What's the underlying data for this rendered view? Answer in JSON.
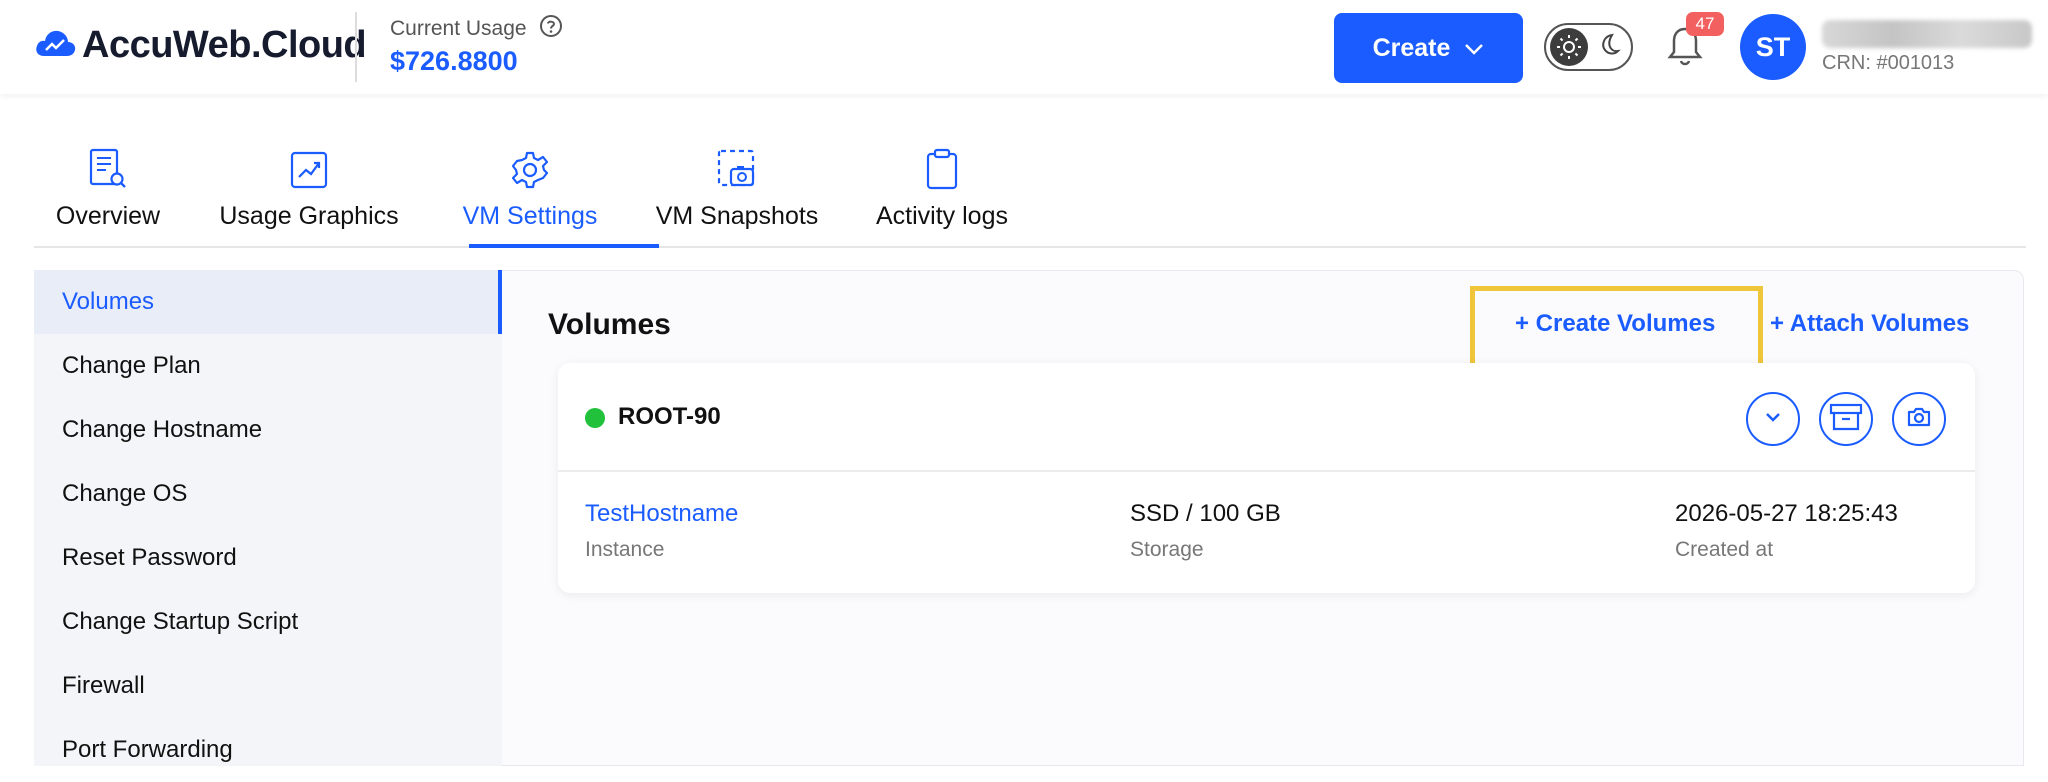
{
  "header": {
    "logo_text": "AccuWeb.Cloud",
    "usage_label": "Current Usage",
    "usage_value": "$726.8800",
    "create_label": "Create",
    "notification_count": "47",
    "avatar_initials": "ST",
    "crn": "CRN: #001013"
  },
  "tabs": [
    {
      "label": "Overview",
      "icon": "document-search-icon"
    },
    {
      "label": "Usage Graphics",
      "icon": "chart-trend-icon"
    },
    {
      "label": "VM Settings",
      "icon": "gear-icon",
      "active": true
    },
    {
      "label": "VM Snapshots",
      "icon": "snapshot-icon"
    },
    {
      "label": "Activity logs",
      "icon": "clipboard-icon"
    }
  ],
  "sidebar": {
    "items": [
      {
        "label": "Volumes",
        "active": true
      },
      {
        "label": "Change Plan"
      },
      {
        "label": "Change Hostname"
      },
      {
        "label": "Change OS"
      },
      {
        "label": "Reset Password"
      },
      {
        "label": "Change Startup Script"
      },
      {
        "label": "Firewall"
      },
      {
        "label": "Port Forwarding"
      }
    ]
  },
  "main": {
    "title": "Volumes",
    "create_link": "+ Create Volumes",
    "attach_link": "+ Attach Volumes",
    "volume": {
      "name": "ROOT-90",
      "status_color": "#21c13b",
      "instance_value": "TestHostname",
      "instance_label": "Instance",
      "storage_value": "SSD / 100 GB",
      "storage_label": "Storage",
      "created_value": "2026-05-27 18:25:43",
      "created_label": "Created at"
    }
  },
  "colors": {
    "accent": "#1a5cff",
    "highlight": "#efc53a",
    "badge": "#f26060"
  }
}
